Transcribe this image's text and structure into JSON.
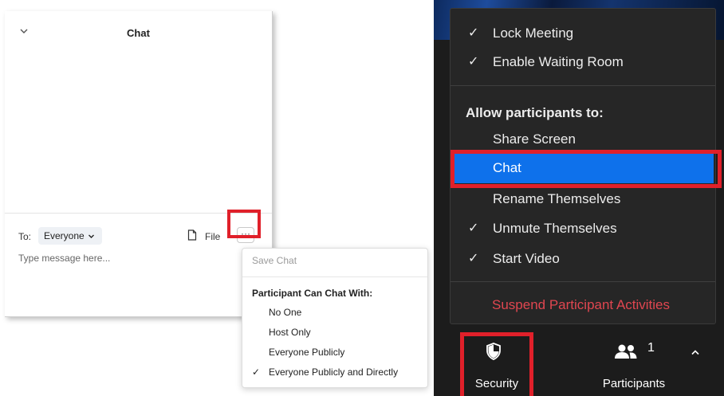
{
  "chat_panel": {
    "title": "Chat",
    "to_label": "To:",
    "recipient": "Everyone",
    "file_label": "File",
    "more_label": "···",
    "message_placeholder": "Type message here..."
  },
  "chat_options": {
    "save_chat": "Save Chat",
    "heading": "Participant Can Chat With:",
    "options": [
      "No One",
      "Host Only",
      "Everyone Publicly",
      "Everyone Publicly and Directly"
    ],
    "selected_index": 3,
    "check_mark": "✓"
  },
  "security_menu": {
    "lock_meeting": "Lock Meeting",
    "enable_waiting_room": "Enable Waiting Room",
    "heading": "Allow participants to:",
    "share_screen": "Share Screen",
    "chat": "Chat",
    "rename_themselves": "Rename Themselves",
    "unmute_themselves": "Unmute Themselves",
    "start_video": "Start Video",
    "suspend": "Suspend Participant Activities",
    "check_mark": "✓"
  },
  "toolbar": {
    "security_label": "Security",
    "participants_label": "Participants",
    "participants_count": "1"
  },
  "colors": {
    "highlight": "#e0202a",
    "selected": "#0e71eb",
    "menu_bg": "#262626",
    "suspend_text": "#e04650"
  },
  "icons": [
    "chevron-down-icon",
    "file-icon",
    "more-icon",
    "shield-icon",
    "people-icon",
    "caret-up-icon",
    "check-icon"
  ]
}
